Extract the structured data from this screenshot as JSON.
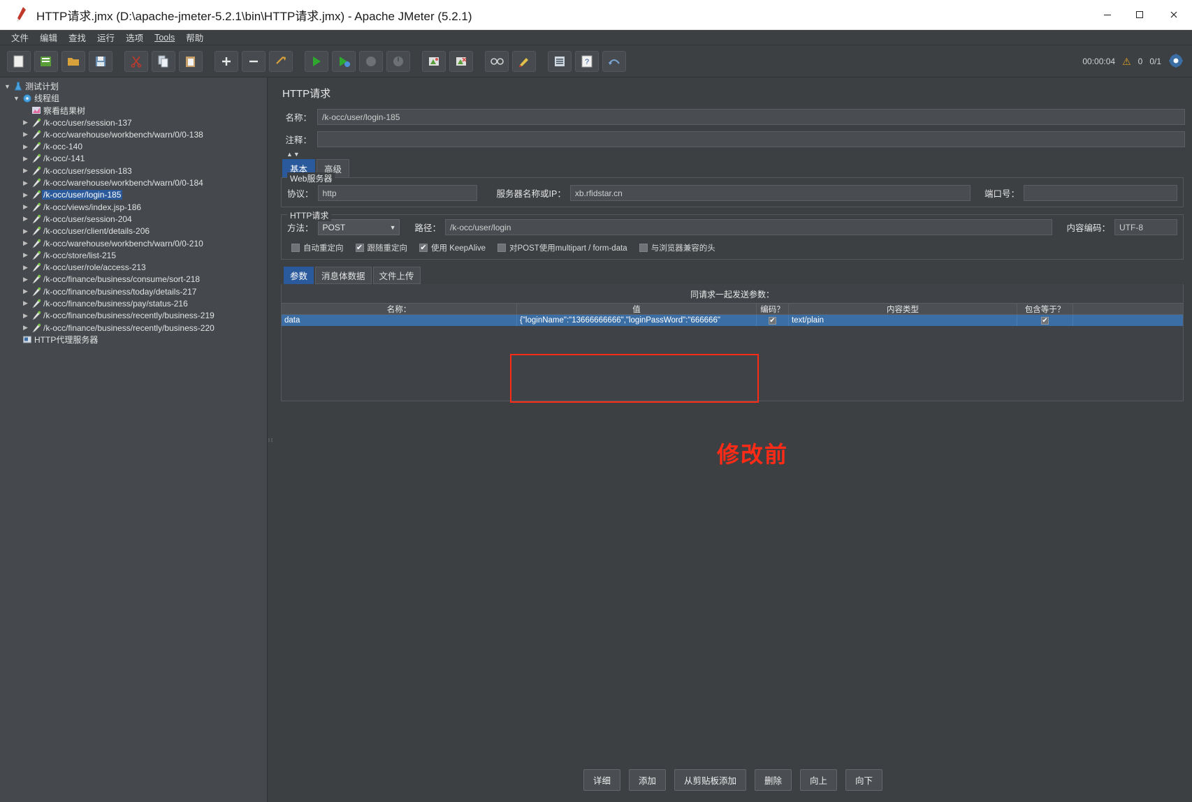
{
  "window": {
    "title": "HTTP请求.jmx (D:\\apache-jmeter-5.2.1\\bin\\HTTP请求.jmx) - Apache JMeter (5.2.1)",
    "minimize": "─",
    "maximize": "☐",
    "close": "✕"
  },
  "menubar": {
    "items": [
      {
        "label": "文件"
      },
      {
        "label": "编辑"
      },
      {
        "label": "查找"
      },
      {
        "label": "运行"
      },
      {
        "label": "选项"
      },
      {
        "label": "Tools"
      },
      {
        "label": "帮助"
      }
    ]
  },
  "toolbar": {
    "timer": "00:00:04",
    "warn_count": "0",
    "thread_count": "0/1"
  },
  "tree": {
    "items": [
      {
        "label": "测试计划",
        "indent": 1,
        "toggle": "down",
        "icon": "test-plan-icon",
        "selected": false
      },
      {
        "label": "线程组",
        "indent": 2,
        "toggle": "down",
        "icon": "thread-group-icon",
        "selected": false
      },
      {
        "label": "察看结果树",
        "indent": 3,
        "toggle": "none",
        "icon": "view-results-tree-icon",
        "selected": false
      },
      {
        "label": "/k-occ/user/session-137",
        "indent": 3,
        "toggle": "right",
        "icon": "http-sampler-icon",
        "selected": false
      },
      {
        "label": "/k-occ/warehouse/workbench/warn/0/0-138",
        "indent": 3,
        "toggle": "right",
        "icon": "http-sampler-icon",
        "selected": false
      },
      {
        "label": "/k-occ-140",
        "indent": 3,
        "toggle": "right",
        "icon": "http-sampler-icon",
        "selected": false
      },
      {
        "label": "/k-occ/-141",
        "indent": 3,
        "toggle": "right",
        "icon": "http-sampler-icon",
        "selected": false
      },
      {
        "label": "/k-occ/user/session-183",
        "indent": 3,
        "toggle": "right",
        "icon": "http-sampler-icon",
        "selected": false
      },
      {
        "label": "/k-occ/warehouse/workbench/warn/0/0-184",
        "indent": 3,
        "toggle": "right",
        "icon": "http-sampler-icon",
        "selected": false
      },
      {
        "label": "/k-occ/user/login-185",
        "indent": 3,
        "toggle": "right",
        "icon": "http-sampler-icon",
        "selected": true
      },
      {
        "label": "/k-occ/views/index.jsp-186",
        "indent": 3,
        "toggle": "right",
        "icon": "http-sampler-icon",
        "selected": false
      },
      {
        "label": "/k-occ/user/session-204",
        "indent": 3,
        "toggle": "right",
        "icon": "http-sampler-icon",
        "selected": false
      },
      {
        "label": "/k-occ/user/client/details-206",
        "indent": 3,
        "toggle": "right",
        "icon": "http-sampler-icon",
        "selected": false
      },
      {
        "label": "/k-occ/warehouse/workbench/warn/0/0-210",
        "indent": 3,
        "toggle": "right",
        "icon": "http-sampler-icon",
        "selected": false
      },
      {
        "label": "/k-occ/store/list-215",
        "indent": 3,
        "toggle": "right",
        "icon": "http-sampler-icon",
        "selected": false
      },
      {
        "label": "/k-occ/user/role/access-213",
        "indent": 3,
        "toggle": "right",
        "icon": "http-sampler-icon",
        "selected": false
      },
      {
        "label": "/k-occ/finance/business/consume/sort-218",
        "indent": 3,
        "toggle": "right",
        "icon": "http-sampler-icon",
        "selected": false
      },
      {
        "label": "/k-occ/finance/business/today/details-217",
        "indent": 3,
        "toggle": "right",
        "icon": "http-sampler-icon",
        "selected": false
      },
      {
        "label": "/k-occ/finance/business/pay/status-216",
        "indent": 3,
        "toggle": "right",
        "icon": "http-sampler-icon",
        "selected": false
      },
      {
        "label": "/k-occ/finance/business/recently/business-219",
        "indent": 3,
        "toggle": "right",
        "icon": "http-sampler-icon",
        "selected": false
      },
      {
        "label": "/k-occ/finance/business/recently/business-220",
        "indent": 3,
        "toggle": "right",
        "icon": "http-sampler-icon",
        "selected": false
      },
      {
        "label": "HTTP代理服务器",
        "indent": 2,
        "toggle": "none",
        "icon": "http-proxy-icon",
        "selected": false
      }
    ]
  },
  "editor": {
    "panel_title": "HTTP请求",
    "name_label": "名称：",
    "name_value": "/k-occ/user/login-185",
    "comment_label": "注释：",
    "comment_value": "",
    "tabs": [
      {
        "label": "基本",
        "active": true
      },
      {
        "label": "高级",
        "active": false
      }
    ],
    "web_server": {
      "group_title": "Web服务器",
      "protocol_label": "协议：",
      "protocol_value": "http",
      "server_label": "服务器名称或IP：",
      "server_value": "xb.rfidstar.cn",
      "port_label": "端口号：",
      "port_value": ""
    },
    "http_request": {
      "group_title": "HTTP请求",
      "method_label": "方法：",
      "method_value": "POST",
      "path_label": "路径：",
      "path_value": "/k-occ/user/login",
      "encoding_label": "内容编码：",
      "encoding_value": "UTF-8",
      "checkboxes": [
        {
          "label": "自动重定向",
          "checked": false
        },
        {
          "label": "跟随重定向",
          "checked": true
        },
        {
          "label": "使用 KeepAlive",
          "checked": true
        },
        {
          "label": "对POST使用multipart / form-data",
          "checked": false
        },
        {
          "label": "与浏览器兼容的头",
          "checked": false
        }
      ]
    },
    "param_tabs": [
      {
        "label": "参数",
        "active": true
      },
      {
        "label": "消息体数据",
        "active": false
      },
      {
        "label": "文件上传",
        "active": false
      }
    ],
    "params_table": {
      "send_label": "同请求一起发送参数：",
      "headers": [
        "名称：",
        "值",
        "编码？",
        "内容类型",
        "包含等于？"
      ],
      "rows": [
        {
          "name": "data",
          "value": "{\"loginName\":\"13666666666\",\"loginPassWord\":\"666666\"",
          "encode": true,
          "content_type": "text/plain",
          "include_equals": true
        }
      ]
    },
    "annotation": {
      "text": "修改前",
      "color": "#ff2b17"
    },
    "buttons": [
      {
        "label": "详细"
      },
      {
        "label": "添加"
      },
      {
        "label": "从剪贴板添加"
      },
      {
        "label": "删除"
      },
      {
        "label": "向上"
      },
      {
        "label": "向下"
      }
    ]
  }
}
